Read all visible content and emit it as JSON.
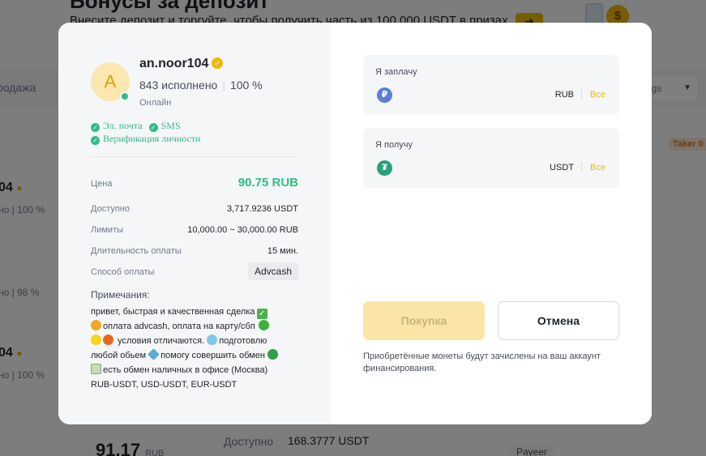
{
  "background": {
    "banner_title": "Бонусы за депозит",
    "banner_subtitle": "Внесите депозит и торгуйте, чтобы получить часть из 100 000 USDT в призах",
    "banner_arrow": "➔",
    "coin_symbol": "$",
    "tab_sell": "родажа",
    "select_text": "ngs",
    "taker_badge": "Taker 0",
    "rows": [
      {
        "nick_tail": "04",
        "stat": "но  |  100 %"
      },
      {
        "nick_tail": "",
        "stat": "но  |  98 %"
      },
      {
        "nick_tail": "04",
        "stat": "но  |  100 %"
      }
    ],
    "bottom_price": "91.17",
    "bottom_price_currency": "RUB",
    "bottom_available_label": "Доступно",
    "bottom_available_value": "168.3777 USDT",
    "bottom_payment": "Payeer"
  },
  "modal": {
    "merchant": {
      "avatar_letter": "A",
      "nickname": "an.noor104",
      "orders_completed": "843 исполнено",
      "completion_rate": "100 %",
      "status": "Онлайн",
      "verifications": [
        "Эл. почта",
        "SMS",
        "Верификация личности"
      ]
    },
    "details": {
      "price_label": "Цена",
      "price_value": "90.75 RUB",
      "available_label": "Доступно",
      "available_value": "3,717.9236 USDT",
      "limits_label": "Лимиты",
      "limits_value": "10,000.00 ~ 30,000.00 RUB",
      "duration_label": "Длительность оплаты",
      "duration_value": "15 мин.",
      "payment_label": "Способ оплаты",
      "payment_value": "Advcash"
    },
    "notes_label": "Примечания:",
    "notes": {
      "l1": "привет, быстрая и качественная сделка",
      "l2": "оплата advcash, оплата на карту/сбп",
      "l3": "условия отличаются.",
      "l3b": "подготовлю",
      "l4": "любой обьем",
      "l4b": "помогу совершить обмен",
      "l5": "есть обмен наличных в офисе (Москва)",
      "l6": "RUB-USDT, USD-USDT, EUR-USDT"
    },
    "pay": {
      "label": "Я заплачу",
      "currency": "RUB",
      "icon_symbol": "₽",
      "all": "Все"
    },
    "receive": {
      "label": "Я получу",
      "currency": "USDT",
      "icon_symbol": "₮",
      "all": "Все"
    },
    "buy_button": "Покупка",
    "cancel_button": "Отмена",
    "hint": "Приобретённые монеты будут зачислены на ваш аккаунт финансирования."
  },
  "colors": {
    "accent": "#f0b90b",
    "success": "#2ebd85",
    "rub_icon": "#5b7fd6",
    "usdt_icon": "#26a17b"
  }
}
